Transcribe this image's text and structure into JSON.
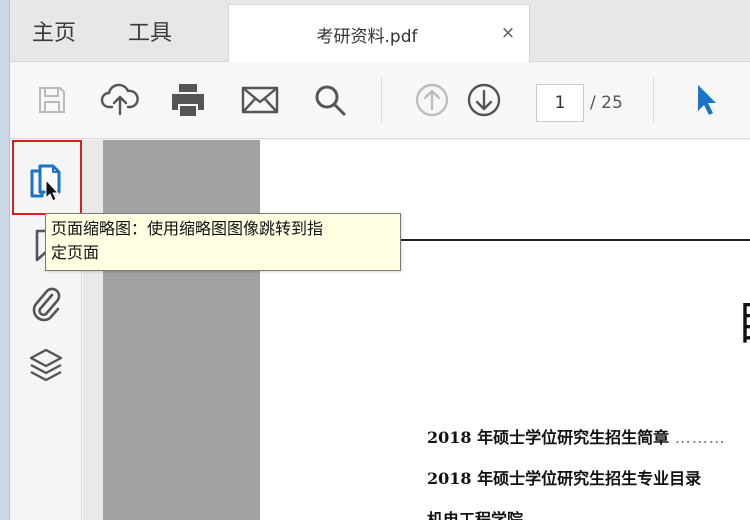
{
  "tabs": {
    "home_label": "主页",
    "tools_label": "工具",
    "document_title": "考研资料.pdf",
    "close_glyph": "×"
  },
  "toolbar": {
    "icons": [
      "save-icon",
      "upload-cloud-icon",
      "print-icon",
      "mail-icon",
      "search-icon",
      "page-up-icon",
      "page-down-icon",
      "select-cursor-icon"
    ],
    "current_page": "1",
    "total_pages": "/ 25",
    "accent_color": "#1a73c7"
  },
  "navpane": {
    "icons": [
      "page-thumbnails-icon",
      "bookmark-icon",
      "attachment-icon",
      "layers-icon"
    ],
    "highlight_color": "#e21b1b"
  },
  "tooltip": {
    "line1": "页面缩略图：使用缩略图图像跳转到指",
    "line2": "定页面"
  },
  "document": {
    "heading_char": "目",
    "toc_items": [
      "2018 年硕士学位研究生招生简章",
      "2018 年硕士学位研究生招生专业目录",
      "机电工程学院"
    ],
    "toc_leader": "………"
  }
}
